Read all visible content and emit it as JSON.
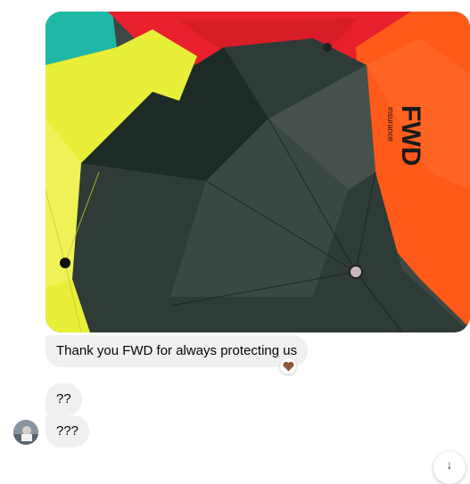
{
  "conversation": {
    "photo": {
      "brand_text": "FWD",
      "brand_subtext": "insurance"
    },
    "messages": [
      {
        "text": "Thank you FWD for always protecting us",
        "reaction": "heart-icon"
      },
      {
        "text": "??"
      },
      {
        "text": "???"
      }
    ],
    "scroll_button": {
      "icon": "arrow-down-icon",
      "glyph": "↓"
    }
  },
  "colors": {
    "bubble_bg": "#f0f0f0",
    "umbrella_yellow": "#e9ee38",
    "umbrella_dark_green": "#2f3b36",
    "umbrella_red": "#e8202c",
    "umbrella_orange": "#ff5a1a",
    "umbrella_teal": "#1fb8a6",
    "reaction_heart": "#8a5a3b"
  }
}
